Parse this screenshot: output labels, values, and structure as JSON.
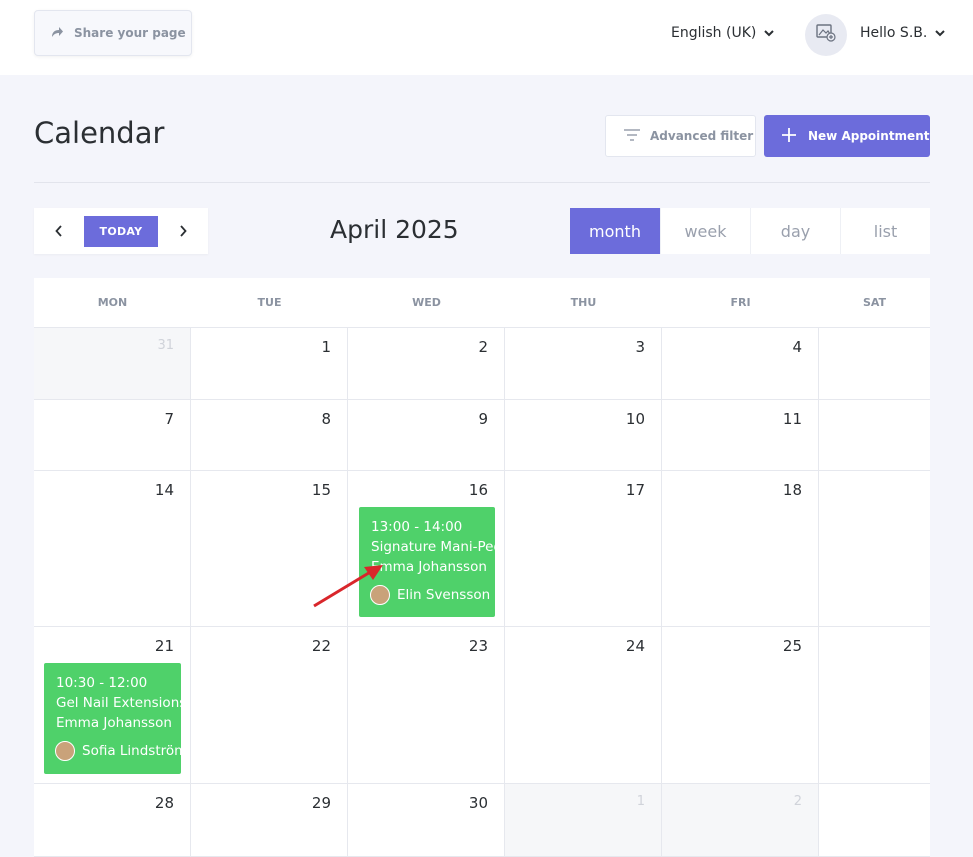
{
  "topbar": {
    "share_label": "Share your page",
    "language": "English (UK)",
    "greeting": "Hello S.B."
  },
  "header": {
    "title": "Calendar",
    "advanced_filter_label": "Advanced filter",
    "new_appointment_label": "New Appointment"
  },
  "toolbar": {
    "today_label": "TODAY",
    "current_period": "April 2025",
    "views": [
      "month",
      "week",
      "day",
      "list"
    ],
    "active_view": "month"
  },
  "calendar": {
    "weekdays": [
      "MON",
      "TUE",
      "WED",
      "THU",
      "FRI",
      "SAT"
    ],
    "weeks": [
      [
        "31",
        "1",
        "2",
        "3",
        "4",
        ""
      ],
      [
        "7",
        "8",
        "9",
        "10",
        "11",
        ""
      ],
      [
        "14",
        "15",
        "16",
        "17",
        "18",
        ""
      ],
      [
        "21",
        "22",
        "23",
        "24",
        "25",
        ""
      ],
      [
        "28",
        "29",
        "30",
        "1",
        "2",
        ""
      ]
    ],
    "events": [
      {
        "time": "13:00 - 14:00",
        "service": "Signature Mani-Pedi",
        "client": "Emma Johansson",
        "staff": "Elin Svensson",
        "color": "#4fd16a"
      },
      {
        "time": "10:30 - 12:00",
        "service": "Gel Nail Extensions",
        "client": "Emma Johansson",
        "staff": "Sofia Lindström",
        "color": "#4fd16a"
      }
    ]
  },
  "colors": {
    "accent": "#6c6cdb",
    "event_green": "#4fd16a",
    "annotation_arrow": "#d9262b"
  }
}
